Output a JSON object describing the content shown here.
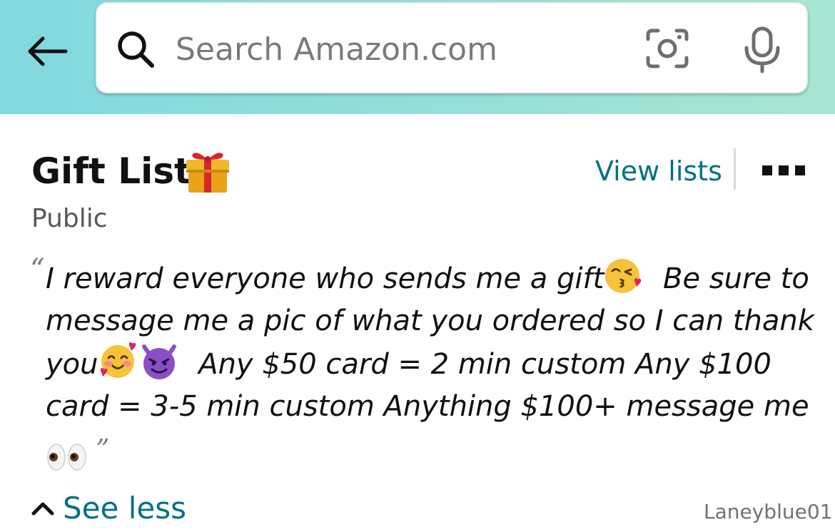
{
  "header": {
    "back_icon": "arrow-left-icon",
    "search": {
      "placeholder": "Search Amazon.com",
      "search_icon": "search-icon",
      "camera_icon": "camera-scan-icon",
      "mic_icon": "microphone-icon"
    },
    "gradient_colors": [
      "#80d9df",
      "#a7e6d2"
    ]
  },
  "list": {
    "title": "Gift List",
    "title_emoji": "gift-icon",
    "privacy": "Public",
    "view_lists_label": "View lists",
    "more_icon": "more-options-icon",
    "description_lines": [
      "I reward everyone who sends me a gift",
      "Be sure to",
      "message me a pic of what you ordered so I can thank",
      "you",
      "Any $50 card = 2 min custom Any $100",
      "card = 3-5 min custom Anything $100+ message me"
    ],
    "description_emojis": [
      "kissing-face-icon",
      "smiling-hearts-face-icon",
      "smiling-devil-icon",
      "eyes-icon"
    ],
    "see_less_label": "See less",
    "owner": "Laneyblue01"
  },
  "colors": {
    "link": "#007185",
    "secondary_text": "#565959"
  }
}
